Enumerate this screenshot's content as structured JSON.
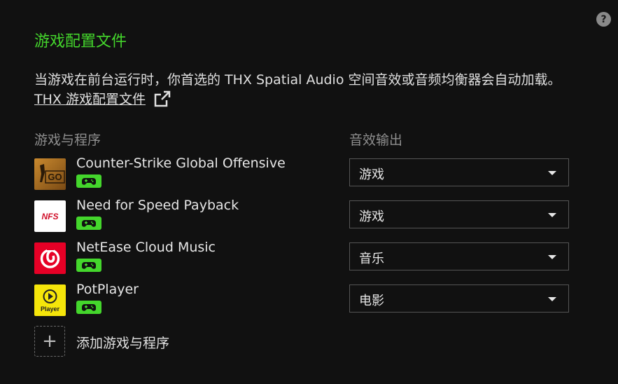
{
  "help_label": "?",
  "title": "游戏配置文件",
  "description": {
    "text": "当游戏在前台运行时，你首选的 THX Spatial Audio 空间音效或音频均衡器会自动加载。",
    "link": "THX 游戏配置文件"
  },
  "columns": {
    "apps": "游戏与程序",
    "output": "音效输出"
  },
  "apps": [
    {
      "name": "Counter-Strike Global Offensive",
      "output": "游戏",
      "icon": "csgo-icon",
      "icon_text": "GO"
    },
    {
      "name": "Need for Speed Payback",
      "output": "游戏",
      "icon": "nfs-icon",
      "icon_text": "NFS"
    },
    {
      "name": "NetEase Cloud Music",
      "output": "音乐",
      "icon": "netease-icon",
      "icon_text": ""
    },
    {
      "name": "PotPlayer",
      "output": "电影",
      "icon": "potplayer-icon",
      "icon_text": "Player"
    }
  ],
  "add_label": "添加游戏与程序",
  "add_symbol": "+",
  "colors": {
    "accent": "#44d62c",
    "background": "#111111"
  }
}
